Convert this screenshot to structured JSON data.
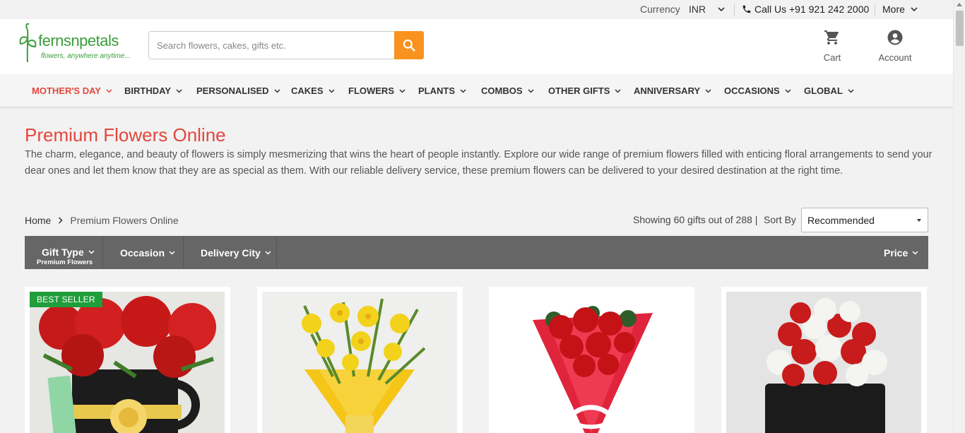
{
  "topbar": {
    "currency_label": "Currency",
    "currency_value": "INR",
    "call_text": "Call Us +91 921 242 2000",
    "more_label": "More"
  },
  "header": {
    "logo_word": "fernsnpetals",
    "logo_tagline": "flowers, anywhere anytime...",
    "search_placeholder": "Search flowers, cakes, gifts etc.",
    "cart_label": "Cart",
    "account_label": "Account"
  },
  "nav": {
    "items": [
      {
        "label": "MOTHER'S DAY"
      },
      {
        "label": "BIRTHDAY"
      },
      {
        "label": "PERSONALISED"
      },
      {
        "label": "CAKES"
      },
      {
        "label": "FLOWERS"
      },
      {
        "label": "PLANTS"
      },
      {
        "label": "COMBOS"
      },
      {
        "label": "OTHER GIFTS"
      },
      {
        "label": "ANNIVERSARY"
      },
      {
        "label": "OCCASIONS"
      },
      {
        "label": "GLOBAL"
      }
    ]
  },
  "page": {
    "title": "Premium Flowers Online",
    "description": "The charm, elegance, and beauty of flowers is simply mesmerizing that wins the heart of people instantly. Explore our wide range of premium flowers filled with enticing floral arrangements to send your dear ones and let them know that they are as special as them. With our reliable delivery service, these premium flowers can be delivered to your desired destination at the right time."
  },
  "breadcrumb": {
    "home": "Home",
    "current": "Premium Flowers Online"
  },
  "listing": {
    "showing": "Showing 60 gifts out of 288 |",
    "sort_label": "Sort By",
    "sort_value": "Recommended"
  },
  "filters": {
    "gift_type": "Gift Type",
    "gift_type_sub": "Premium Flowers",
    "occasion": "Occasion",
    "delivery_city": "Delivery City",
    "price": "Price"
  },
  "products": {
    "badge": "BEST SELLER"
  },
  "colors": {
    "accent": "#e1473d",
    "search_button": "#f7931e",
    "badge": "#1f9e3b",
    "filterbar": "#666666"
  }
}
